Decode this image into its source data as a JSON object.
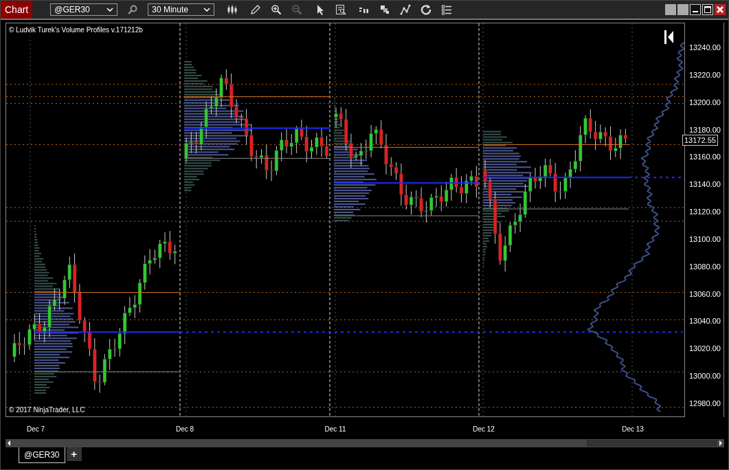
{
  "window": {
    "title": "Chart"
  },
  "toolbar": {
    "instrument": "@GER30",
    "interval": "30 Minute"
  },
  "chart": {
    "indicator_label": "© Ludvik Turek's Volume Profiles v.171212b",
    "copyright": "© 2017 NinjaTrader, LLC",
    "price_axis": {
      "labels": [
        "13240.00",
        "13220.00",
        "13200.00",
        "13180.00",
        "13160.00",
        "13140.00",
        "13120.00",
        "13100.00",
        "13080.00",
        "13060.00",
        "13040.00",
        "13020.00",
        "13000.00",
        "12980.00"
      ],
      "current_price": "13172.55"
    },
    "time_axis": {
      "labels": [
        "Dec 7",
        "Dec 8",
        "Dec 11",
        "Dec 12",
        "Dec 13"
      ]
    }
  },
  "tabs": [
    {
      "label": "@GER30",
      "selected": true
    }
  ],
  "add_tab": "+"
}
